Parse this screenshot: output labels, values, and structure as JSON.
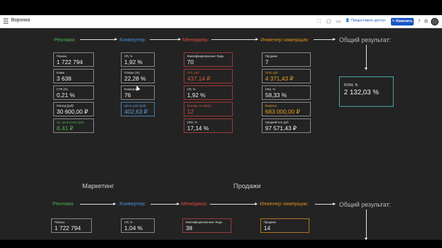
{
  "app": {
    "title": "Воронка",
    "share_label": "Предоставить доступ",
    "edit_label": "Изменить"
  },
  "colors": {
    "ads": "#4caf50",
    "converter": "#4a90d9",
    "manager": "#e04a3a",
    "engineer": "#d98f1a",
    "result": "#bdbdbd",
    "ads_highlight": "#4caf50",
    "converter_highlight": "#5a9fdf",
    "manager_highlight": "#d05a3a",
    "engineer_highlight": "#e0a020"
  },
  "icons": {
    "menu": "menu-icon",
    "expand": "expand-icon",
    "frame": "frame-icon",
    "comment": "comment-icon",
    "share": "share-icon",
    "edit": "pencil-icon",
    "help": "help-icon",
    "settings": "gear-icon"
  },
  "funnel": {
    "stages": {
      "ads": "Реклама",
      "converter": "Конвертер:",
      "manager": "Менеджер:",
      "engineer": "Инженер-замерщик:",
      "result": "Общий результат:"
    },
    "ads_cards": [
      {
        "label": "Показы",
        "value": "1 722 794"
      },
      {
        "label": "Клики",
        "value": "3 638"
      },
      {
        "label": "CTR (%)",
        "value": "0,21 %"
      },
      {
        "label": "Расход (руб)",
        "value": "30 600,00 ₽"
      },
      {
        "label": "Ср. цена клика (руб)",
        "value": "8,41 ₽"
      }
    ],
    "converter_cards": [
      {
        "label": "CR, %",
        "value": "1,92 %"
      },
      {
        "label": "Отказы (%)",
        "value": "22,28 %"
      },
      {
        "label": "Конверсии",
        "value": "76"
      },
      {
        "label": "Цена цели (руб)",
        "value": "402,63 ₽"
      }
    ],
    "manager_cards": [
      {
        "label": "Квалифицированные Лиды",
        "value": "70"
      },
      {
        "label": "CPL, руб",
        "value": "437,14 ₽"
      },
      {
        "label": "CR, %",
        "value": "1,92 %"
      },
      {
        "label": "Выезды на Замер",
        "value": "12"
      },
      {
        "label": "CR2, %",
        "value": "17,14 %"
      }
    ],
    "engineer_cards": [
      {
        "label": "Продажи",
        "value": "7"
      },
      {
        "label": "CPO, руб",
        "value": "4 371,43 ₽"
      },
      {
        "label": "CR3, %",
        "value": "58,33 %"
      },
      {
        "label": "Выручка",
        "value": "683 000,00 ₽"
      },
      {
        "label": "Средний чек, руб",
        "value": "97 571,43 ₽"
      }
    ],
    "result_card": {
      "label": "ROMI, %",
      "value": "2 132,03 %"
    }
  },
  "sections": {
    "marketing": "Маркетинг",
    "sales": "Продажи"
  },
  "funnel2": {
    "stages": {
      "ads": "Реклама",
      "converter": "Конвертер:",
      "manager": "Менеджер:",
      "engineer": "Инженер-замерщик:",
      "result": "Общий результат:"
    },
    "ads_cards": [
      {
        "label": "Показы",
        "value": "1 722 794"
      }
    ],
    "converter_cards": [
      {
        "label": "CR, %",
        "value": "1,04 %"
      }
    ],
    "manager_cards": [
      {
        "label": "Квалифицированные Лиды",
        "value": "38"
      }
    ],
    "engineer_cards": [
      {
        "label": "Продажи",
        "value": "14"
      }
    ]
  }
}
